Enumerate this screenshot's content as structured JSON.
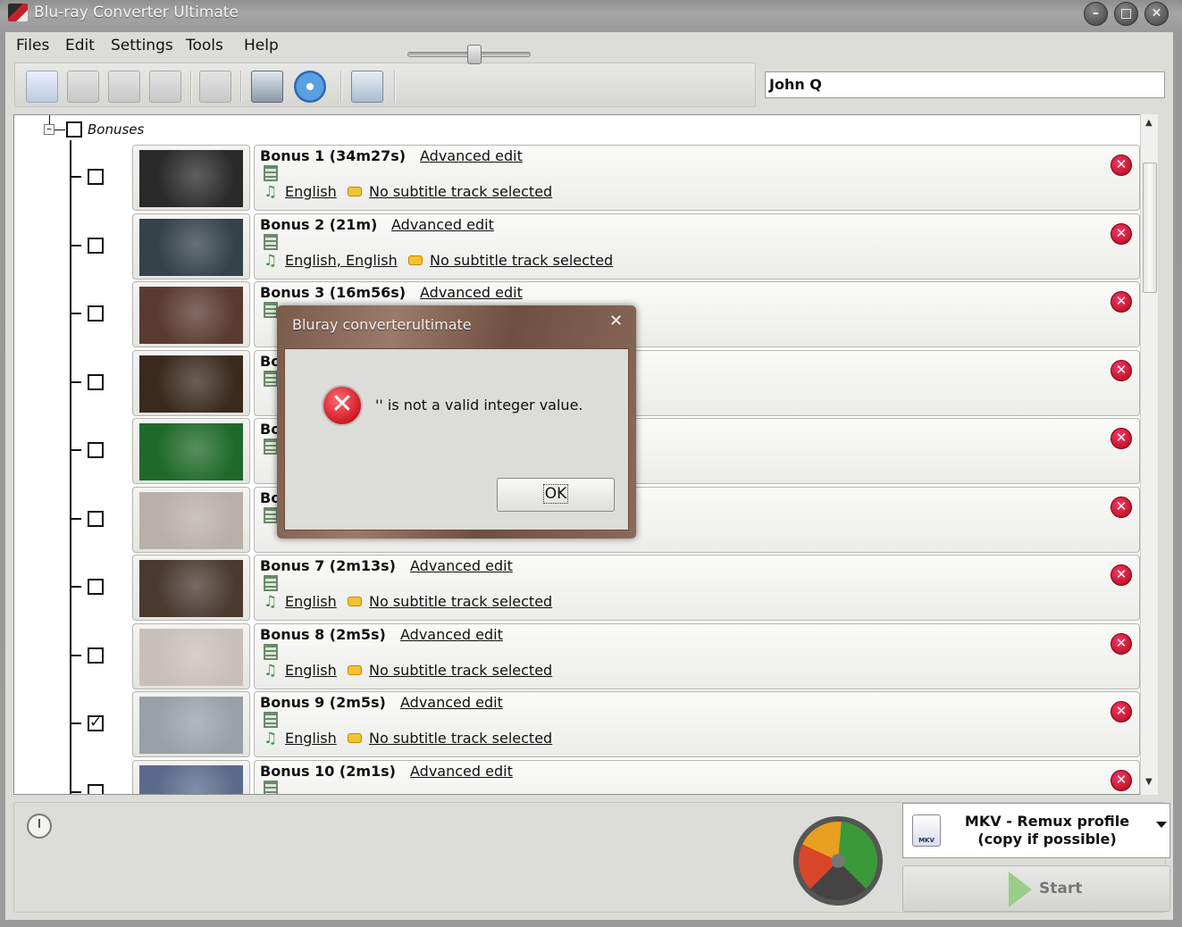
{
  "window": {
    "title": "Blu-ray Converter Ultimate"
  },
  "menu": [
    "Files",
    "Edit",
    "Settings",
    "Tools",
    "Help"
  ],
  "toolbar": {
    "movie_name": "John Q"
  },
  "tree": {
    "root_label": "Bonuses"
  },
  "bonuses": [
    {
      "title": "Bonus 1 (34m27s)",
      "advanced": "Advanced edit",
      "audio": "English",
      "subtitle": "No subtitle track selected",
      "checked": false,
      "thumb_color": "#2a2a2a"
    },
    {
      "title": "Bonus 2 (21m)",
      "advanced": "Advanced edit",
      "audio": "English, English",
      "subtitle": "No subtitle track selected",
      "checked": false,
      "thumb_color": "#34424a"
    },
    {
      "title": "Bonus 3 (16m56s)",
      "advanced": "Advanced edit",
      "audio": "",
      "subtitle": "",
      "checked": false,
      "thumb_color": "#5a3a30"
    },
    {
      "title": "Bo",
      "advanced": "",
      "audio": "",
      "subtitle": "",
      "checked": false,
      "thumb_color": "#3a2a1e"
    },
    {
      "title": "Bo",
      "advanced": "",
      "audio": "",
      "subtitle": "",
      "checked": false,
      "thumb_color": "#1f6a2a"
    },
    {
      "title": "Bo",
      "advanced": "",
      "audio": "",
      "subtitle": "",
      "checked": false,
      "thumb_color": "#b8b0a8"
    },
    {
      "title": "Bonus 7 (2m13s)",
      "advanced": "Advanced edit",
      "audio": "English",
      "subtitle": "No subtitle track selected",
      "checked": false,
      "thumb_color": "#4a3a30"
    },
    {
      "title": "Bonus 8 (2m5s)",
      "advanced": "Advanced edit",
      "audio": "English",
      "subtitle": "No subtitle track selected",
      "checked": false,
      "thumb_color": "#c8c0b8"
    },
    {
      "title": "Bonus 9 (2m5s)",
      "advanced": "Advanced edit",
      "audio": "English",
      "subtitle": "No subtitle track selected",
      "checked": true,
      "thumb_color": "#9aa0a8"
    },
    {
      "title": "Bonus 10 (2m1s)",
      "advanced": "Advanced edit",
      "audio": "",
      "subtitle": "",
      "checked": false,
      "thumb_color": "#5a6a8a"
    }
  ],
  "profile": {
    "label": "MKV - Remux profile (copy if possible)",
    "icon_text": "MKV"
  },
  "start_button": "Start",
  "dialog": {
    "title": "Bluray converterultimate",
    "message": "'' is not a valid integer value.",
    "ok": "OK"
  }
}
